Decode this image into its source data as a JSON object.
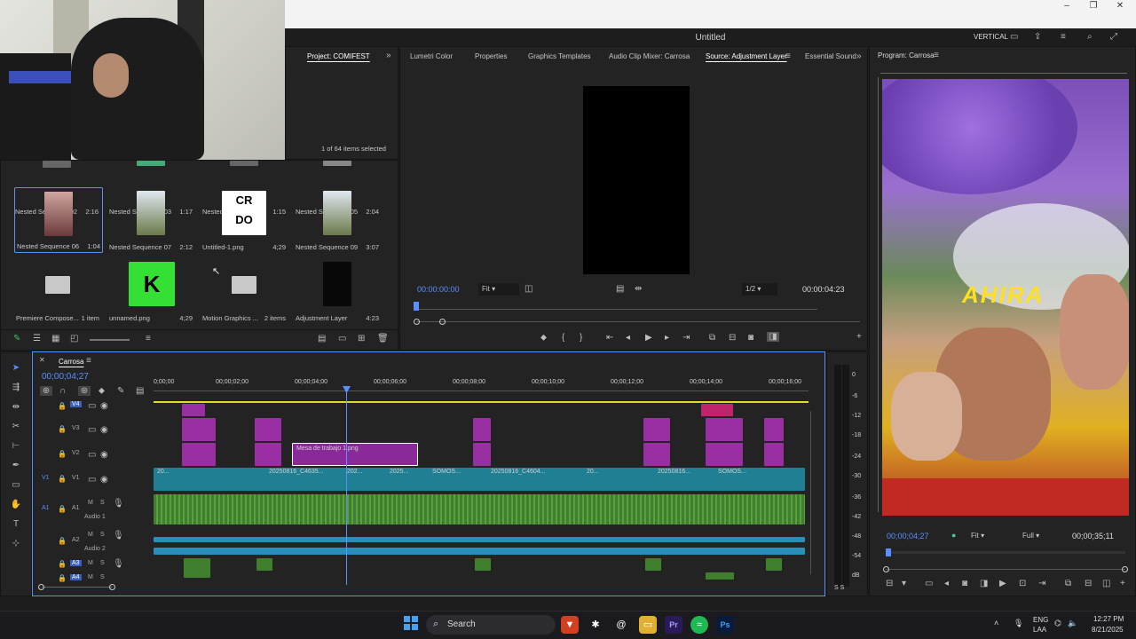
{
  "app": {
    "title": "Untitled",
    "workspace": "VERTICAL"
  },
  "window_controls": {
    "minimize": "–",
    "maximize": "❐",
    "close": "✕"
  },
  "project_panel": {
    "tab": "Project: COMIFEST",
    "selection_status": "1 of 64 items selected",
    "items": [
      {
        "name": "Nested Sequence 02",
        "duration": "2:16"
      },
      {
        "name": "Nested Sequence 03",
        "duration": "1:17"
      },
      {
        "name": "Nested Sequence 04",
        "duration": "1:15"
      },
      {
        "name": "Nested Sequence 05",
        "duration": "2:04"
      },
      {
        "name": "Nested Sequence 06",
        "duration": "1:04"
      },
      {
        "name": "Nested Sequence 07",
        "duration": "2:12"
      },
      {
        "name": "Untitled-1.png",
        "duration": "4;29"
      },
      {
        "name": "Nested Sequence 09",
        "duration": "3:07"
      },
      {
        "name": "Premiere Compose...",
        "duration": "1 item"
      },
      {
        "name": "unnamed.png",
        "duration": "4;29"
      },
      {
        "name": "Motion Graphics ...",
        "duration": "2 items"
      },
      {
        "name": "Adjustment Layer",
        "duration": "4:23"
      }
    ]
  },
  "source_panel": {
    "tabs": [
      "Lumetri Color",
      "Properties",
      "Graphics Templates",
      "Audio Clip Mixer: Carrosa",
      "Source: Adjustment Layer",
      "Essential Sound"
    ],
    "active_tab": "Source: Adjustment Layer",
    "timecode_in": "00:00:00:00",
    "fit": "Fit",
    "resolution": "1/2",
    "timecode_out": "00:00:04:23"
  },
  "program_panel": {
    "tab": "Program: Carrosa",
    "timecode": "00;00;04;27",
    "fit": "Fit",
    "quality": "Full",
    "duration": "00;00;35;11",
    "overlay_text": "AHIRA"
  },
  "timeline": {
    "sequence": "Carrosa",
    "timecode": "00;00;04;27",
    "ruler": [
      "0;00;00",
      "00;00;02;00",
      "00;00;04;00",
      "00;00;06;00",
      "00;00;08;00",
      "00;00;10;00",
      "00;00;12;00",
      "00;00;14;00",
      "00;00;16;00"
    ],
    "tracks": [
      {
        "id": "V4",
        "label": ""
      },
      {
        "id": "V3",
        "label": ""
      },
      {
        "id": "V2",
        "label": ""
      },
      {
        "id": "V1",
        "label": ""
      },
      {
        "id": "A1",
        "label": "Audio 1"
      },
      {
        "id": "A2",
        "label": "Audio 2"
      },
      {
        "id": "A3",
        "label": ""
      },
      {
        "id": "A4",
        "label": ""
      }
    ],
    "clip_labels": {
      "mesa": "Mesa de trabajo 1.png",
      "v1a": "20250816_C4635...",
      "v1b": "202...",
      "v1c": "2025...",
      "v1d": "SOMOS...",
      "v1e": "20250816_C4604...",
      "v1f": "20...",
      "v1g": "20250816...",
      "v1h": "SOMOS...",
      "v1i": "20..."
    },
    "meter_scale": [
      "0",
      "-6",
      "-12",
      "-18",
      "-24",
      "-30",
      "-36",
      "-42",
      "-48",
      "-54",
      "dB"
    ],
    "meter_footer": "S S"
  },
  "taskbar": {
    "search": "Search",
    "lang": "ENG",
    "lang2": "LAA",
    "time": "12:27 PM",
    "date": "8/21/2025"
  },
  "colors": {
    "accent": "#5a8fff",
    "clip_video": "#9a2fa3",
    "clip_pink": "#c0246a",
    "clip_teal": "#1f7f93",
    "clip_audio": "#3f7f2e",
    "audio_blue": "#2a8fb8"
  }
}
